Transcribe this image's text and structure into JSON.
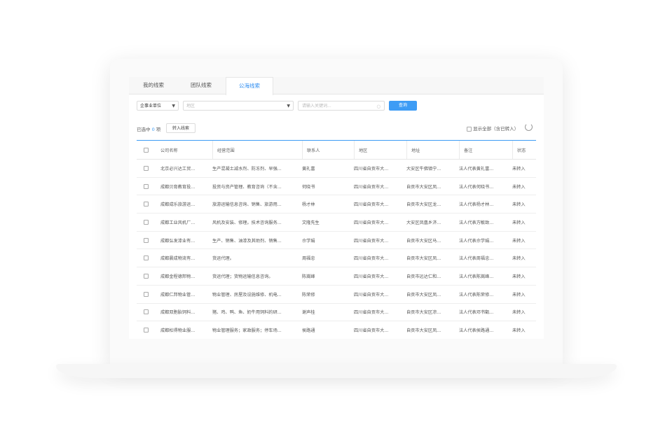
{
  "tabs": [
    "我的线索",
    "团队线索",
    "公海线索"
  ],
  "active_tab": 2,
  "filters": {
    "unit_type": "企事业单位",
    "region_placeholder": "地区",
    "keyword_placeholder": "请输入关键词...",
    "query_label": "查询"
  },
  "toolbar": {
    "selected_prefix": "已选中",
    "selected_count": "0",
    "selected_suffix": "项",
    "transfer_label": "转入线索",
    "show_all_label": "显示全部（含已转入）"
  },
  "table": {
    "headers": [
      "公司名称",
      "经营范围",
      "联系人",
      "地区",
      "地址",
      "备注",
      "状态"
    ],
    "rows": [
      [
        "北京必兴达工贸...",
        "生产混凝土减水剂、防冻剂、早强...",
        "黄礼富",
        "四川省自贡市大...",
        "大安区牛佛镇宁...",
        "法人代表黄礼富...",
        "未转入"
      ],
      [
        "成都贝育教育投...",
        "投资与资产管理、教育咨询（不含...",
        "何晓书",
        "四川省自贡市大...",
        "自贡市大安区凤...",
        "法人代表何晓书...",
        "未转入"
      ],
      [
        "成都成乐旅游运...",
        "旅游运输信息咨询、销售、旅游用...",
        "杨才林",
        "四川省自贡市大...",
        "自贡市大安区龙...",
        "法人代表杨才林...",
        "未转入"
      ],
      [
        "成都工业风机厂...",
        "风机及安装、修理。技术咨询服务...",
        "文隆先生",
        "四川省自贡市大...",
        "大安区凤凰乡济...",
        "法人代表方敏致...",
        "未转入"
      ],
      [
        "成都弘发漆业有...",
        "生产、销售、油漆及其助剂、销售...",
        "佘学娟",
        "四川省自贡市大...",
        "自贡市大安区马...",
        "法人代表佘学娟...",
        "未转入"
      ],
      [
        "成都晨成物流有...",
        "货运代理。",
        "周福忠",
        "四川省自贡市大...",
        "自贡市大安区凤...",
        "法人代表周福忠...",
        "未转入"
      ],
      [
        "成都金程德邦物...",
        "货运代理；货物运输信息咨询。",
        "陈嵩峰",
        "四川省自贡市大...",
        "自贡市远达仁和...",
        "法人代表陈嵩峰...",
        "未转入"
      ],
      [
        "成都仁邦物业管...",
        "物业管理、房屋及设施维修、机电...",
        "陈荣修",
        "四川省自贡市大...",
        "自贡市大安区凤...",
        "法人代表陈荣修...",
        "未转入"
      ],
      [
        "成都双胞胎饲料...",
        "猪、鸡、鸭、鱼、奶牛用饲料的研...",
        "谢声桂",
        "四川省自贡市大...",
        "自贡市大安区凉...",
        "法人代表邓书甑...",
        "未转入"
      ],
      [
        "成都松得物业服...",
        "物业管理服务；家政服务；停车场...",
        "侯路通",
        "四川省自贡市大...",
        "自贡市大安区凤...",
        "法人代表侯路通...",
        "未转入"
      ]
    ]
  },
  "colors": {
    "accent": "#3d9cf5"
  }
}
